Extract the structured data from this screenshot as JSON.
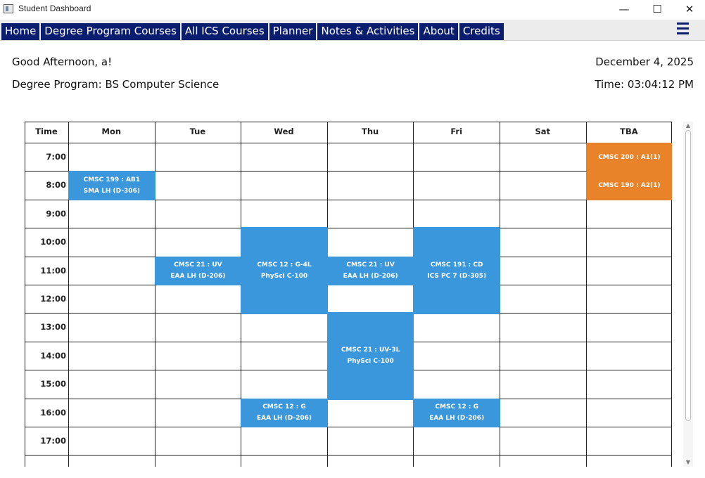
{
  "window": {
    "title": "Student Dashboard",
    "minimize_glyph": "—",
    "maximize_glyph": "☐",
    "close_glyph": "✕"
  },
  "nav": {
    "tabs": [
      {
        "label": "Home"
      },
      {
        "label": "Degree Program Courses"
      },
      {
        "label": "All ICS Courses"
      },
      {
        "label": "Planner"
      },
      {
        "label": "Notes & Activities"
      },
      {
        "label": "About"
      },
      {
        "label": "Credits"
      }
    ],
    "menu_icon": "hamburger-menu-icon"
  },
  "header": {
    "greeting": "Good Afternoon, a!",
    "program": "Degree Program: BS Computer Science",
    "date": "December 4, 2025",
    "time": "Time: 03:04:12 PM"
  },
  "schedule": {
    "time_header": "Time",
    "days": [
      "Mon",
      "Tue",
      "Wed",
      "Thu",
      "Fri",
      "Sat",
      "TBA"
    ],
    "times": [
      "7:00",
      "8:00",
      "9:00",
      "10:00",
      "11:00",
      "12:00",
      "13:00",
      "14:00",
      "15:00",
      "16:00",
      "17:00"
    ],
    "events": [
      {
        "day": 0,
        "start": 1,
        "span": 1,
        "line1": "CMSC 199 : AB1",
        "line2": "SMA LH (D-306)",
        "color": "#3a97db"
      },
      {
        "day": 1,
        "start": 4,
        "span": 1,
        "line1": "CMSC 21 : UV",
        "line2": "EAA LH (D-206)",
        "color": "#3a97db"
      },
      {
        "day": 2,
        "start": 3,
        "span": 3,
        "line1": "CMSC 12 : G-4L",
        "line2": "PhySci C-100",
        "color": "#3a97db"
      },
      {
        "day": 3,
        "start": 4,
        "span": 1,
        "line1": "CMSC 21 : UV",
        "line2": "EAA LH (D-206)",
        "color": "#3a97db"
      },
      {
        "day": 4,
        "start": 3,
        "span": 3,
        "line1": "CMSC 191 : CD",
        "line2": "ICS PC 7 (D-305)",
        "color": "#3a97db"
      },
      {
        "day": 3,
        "start": 6,
        "span": 3,
        "line1": "CMSC 21 : UV-3L",
        "line2": "PhySci C-100",
        "color": "#3a97db"
      },
      {
        "day": 2,
        "start": 9,
        "span": 1,
        "line1": "CMSC 12 : G",
        "line2": "EAA LH (D-206)",
        "color": "#3a97db"
      },
      {
        "day": 4,
        "start": 9,
        "span": 1,
        "line1": "CMSC 12 : G",
        "line2": "EAA LH (D-206)",
        "color": "#3a97db"
      },
      {
        "day": 6,
        "start": 0,
        "span": 1,
        "line1": "CMSC 200 : A1(1)",
        "line2": "",
        "color": "#e8832a"
      },
      {
        "day": 6,
        "start": 1,
        "span": 1,
        "line1": "CMSC 190 : A2(1)",
        "line2": "",
        "color": "#e8832a"
      }
    ]
  },
  "colors": {
    "nav_bg": "#0a1d6f",
    "event_blue": "#3a97db",
    "event_orange": "#e8832a"
  }
}
